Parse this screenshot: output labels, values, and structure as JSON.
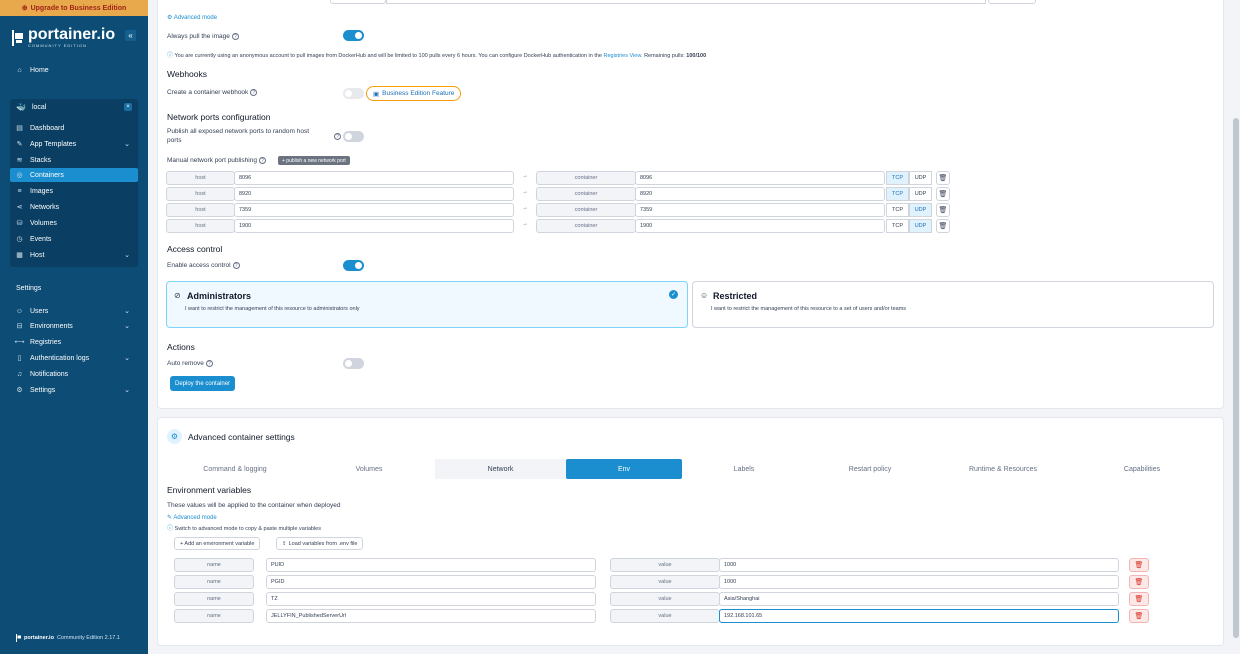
{
  "sidebar": {
    "upgrade": "Upgrade to Business Edition",
    "brand_name": "portainer.io",
    "brand_sub": "COMMUNITY EDITION",
    "collapse": "«",
    "home": "Home",
    "environment": "local",
    "env_close": "×",
    "env_items": [
      {
        "label": "Dashboard",
        "icon": "dashboard-icon",
        "glyph": "▤"
      },
      {
        "label": "App Templates",
        "icon": "edit-icon",
        "glyph": "✎"
      },
      {
        "label": "Stacks",
        "icon": "layers-icon",
        "glyph": "≋"
      },
      {
        "label": "Containers",
        "icon": "container-icon",
        "glyph": "◎"
      },
      {
        "label": "Images",
        "icon": "list-icon",
        "glyph": "≡"
      },
      {
        "label": "Networks",
        "icon": "share-icon",
        "glyph": "⋖"
      },
      {
        "label": "Volumes",
        "icon": "database-icon",
        "glyph": "⛁"
      },
      {
        "label": "Events",
        "icon": "history-icon",
        "glyph": "◷"
      },
      {
        "label": "Host",
        "icon": "server-icon",
        "glyph": "▦"
      }
    ],
    "settings_title": "Settings",
    "settings_items": [
      {
        "label": "Users",
        "icon": "users-icon",
        "glyph": "☺"
      },
      {
        "label": "Environments",
        "icon": "hdd-icon",
        "glyph": "⊟"
      },
      {
        "label": "Registries",
        "icon": "registry-icon",
        "glyph": "⟷"
      },
      {
        "label": "Authentication logs",
        "icon": "file-icon",
        "glyph": "▯"
      },
      {
        "label": "Notifications",
        "icon": "bell-icon",
        "glyph": "♫"
      },
      {
        "label": "Settings",
        "icon": "gear-icon",
        "glyph": "⚙"
      }
    ],
    "footer_brand": "portainer.io",
    "footer_version": "Community Edition 2.17.1",
    "accent": "#1b8ecf"
  },
  "form": {
    "advanced_mode": "Advanced mode",
    "always_pull": "Always pull the image",
    "dockerhub_note": "You are currently using an anonymous account to pull images from DockerHub and will be limited to 100 pulls every 6 hours. You can configure DockerHub authentication in the",
    "registries_link": "Registries View.",
    "remaining_label": "Remaining pulls:",
    "remaining_value": "100/100",
    "webhooks_title": "Webhooks",
    "create_webhook": "Create a container webhook",
    "be_feature": "Business Edition Feature",
    "network_ports_title": "Network ports configuration",
    "publish_all_line1": "Publish all exposed network ports to random host",
    "publish_all_line2": "ports",
    "manual_publishing": "Manual network port publishing",
    "publish_new": "+ publish a new network port",
    "host_label": "host",
    "container_label": "container",
    "ports": [
      {
        "host": "8096",
        "container": "8096",
        "protocol": "TCP"
      },
      {
        "host": "8920",
        "container": "8920",
        "protocol": "TCP"
      },
      {
        "host": "7359",
        "container": "7359",
        "protocol": "UDP"
      },
      {
        "host": "1900",
        "container": "1900",
        "protocol": "UDP"
      }
    ],
    "tcp": "TCP",
    "udp": "UDP",
    "access_control_title": "Access control",
    "enable_access_control": "Enable access control",
    "admins_title": "Administrators",
    "admins_desc": "I want to restrict the management of this resource to administrators only",
    "restricted_title": "Restricted",
    "restricted_desc": "I want to restrict the management of this resource to a set of users and/or teams",
    "actions_title": "Actions",
    "auto_remove": "Auto remove",
    "deploy": "Deploy the container"
  },
  "advanced": {
    "title": "Advanced container settings",
    "tabs": [
      "Command & logging",
      "Volumes",
      "Network",
      "Env",
      "Labels",
      "Restart policy",
      "Runtime & Resources",
      "Capabilities"
    ],
    "env_title": "Environment variables",
    "env_desc": "These values will be applied to the container when deployed",
    "advanced_mode": "Advanced mode",
    "switch_hint": "Switch to advanced mode to copy & paste multiple variables",
    "add_env": "+ Add an environment variable",
    "load_env": "Load variables from .env file",
    "name_label": "name",
    "value_label": "value",
    "vars": [
      {
        "name": "PUID",
        "value": "1000"
      },
      {
        "name": "PGID",
        "value": "1000"
      },
      {
        "name": "TZ",
        "value": "Asia/Shanghai"
      },
      {
        "name": "JELLYFIN_PublishedServerUrl",
        "value": "192.168.101.65"
      }
    ]
  }
}
